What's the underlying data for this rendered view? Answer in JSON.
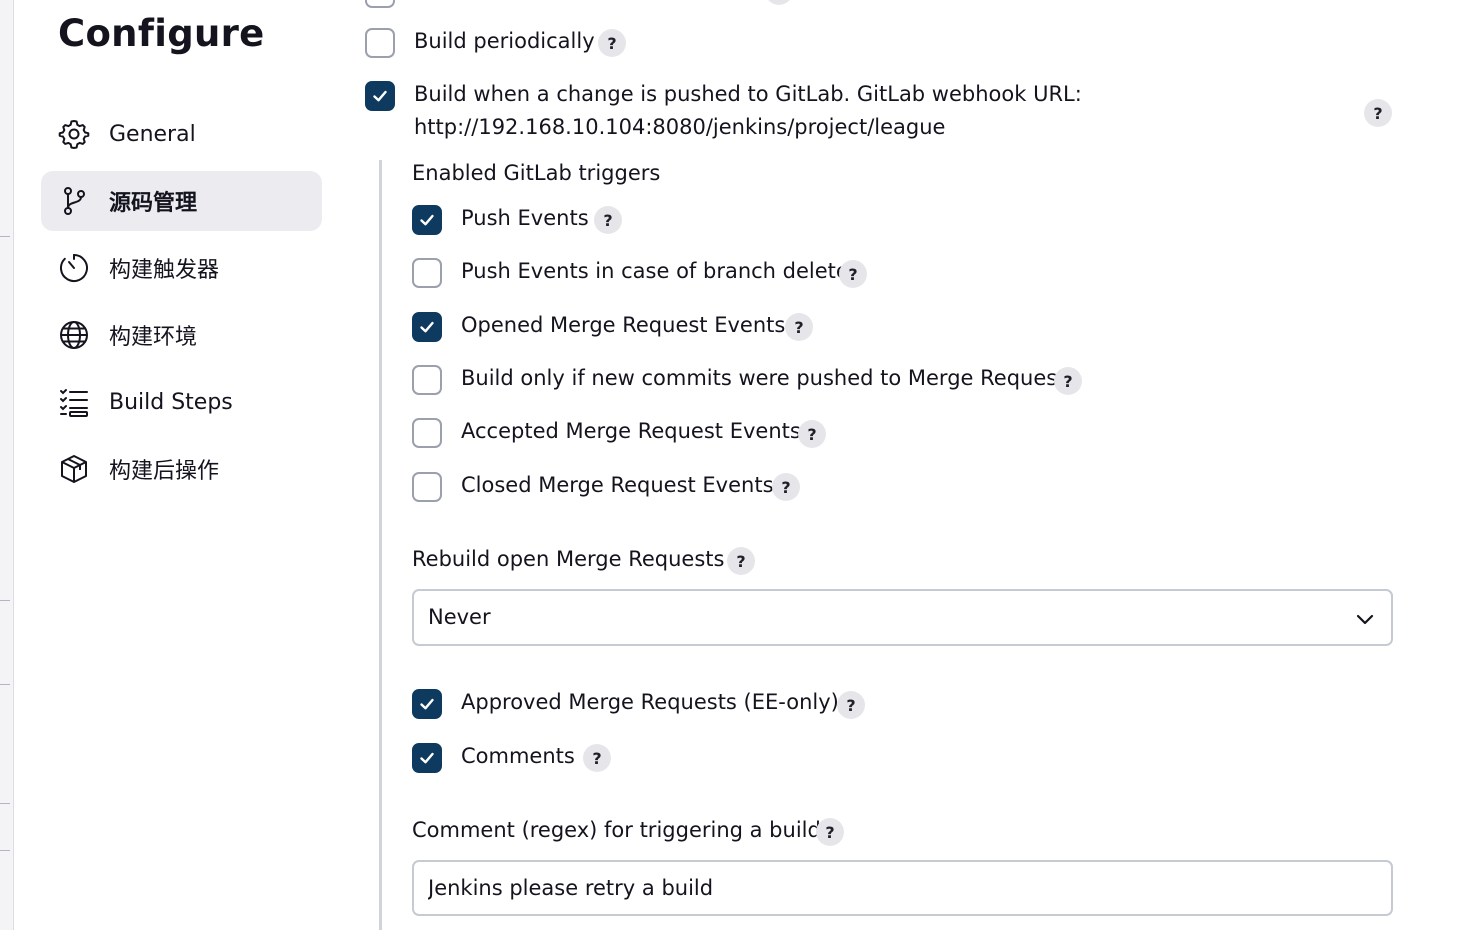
{
  "page_title": "Configure",
  "sidebar": {
    "items": [
      {
        "label": "General",
        "icon": "gear-icon",
        "active": false
      },
      {
        "label": "源码管理",
        "icon": "branch-icon",
        "active": true
      },
      {
        "label": "构建触发器",
        "icon": "clock-icon",
        "active": false
      },
      {
        "label": "构建环境",
        "icon": "globe-icon",
        "active": false
      },
      {
        "label": "Build Steps",
        "icon": "list-icon",
        "active": false
      },
      {
        "label": "构建后操作",
        "icon": "package-icon",
        "active": false
      }
    ]
  },
  "triggers": {
    "build_periodically": {
      "label": "Build periodically",
      "checked": false
    },
    "gitlab_push": {
      "label_line1": "Build when a change is pushed to GitLab. GitLab webhook URL:",
      "label_line2": "http://192.168.10.104:8080/jenkins/project/league",
      "checked": true
    }
  },
  "gitlab": {
    "enabled_triggers_label": "Enabled GitLab triggers",
    "options": [
      {
        "label": "Push Events",
        "checked": true
      },
      {
        "label": "Push Events in case of branch delete",
        "checked": false
      },
      {
        "label": "Opened Merge Request Events",
        "checked": true
      },
      {
        "label": "Build only if new commits were pushed to Merge Request",
        "checked": false
      },
      {
        "label": "Accepted Merge Request Events",
        "checked": false
      },
      {
        "label": "Closed Merge Request Events",
        "checked": false
      }
    ],
    "rebuild_label": "Rebuild open Merge Requests",
    "rebuild_value": "Never",
    "approved": {
      "label": "Approved Merge Requests (EE-only)",
      "checked": true
    },
    "comments": {
      "label": "Comments",
      "checked": true
    },
    "comment_regex_label": "Comment (regex) for triggering a build",
    "comment_regex_value": "Jenkins please retry a build"
  },
  "help_symbol": "?",
  "colors": {
    "accent": "#0d3a5e",
    "active_bg": "#ececf0",
    "help_bg": "#e6e6ea"
  }
}
